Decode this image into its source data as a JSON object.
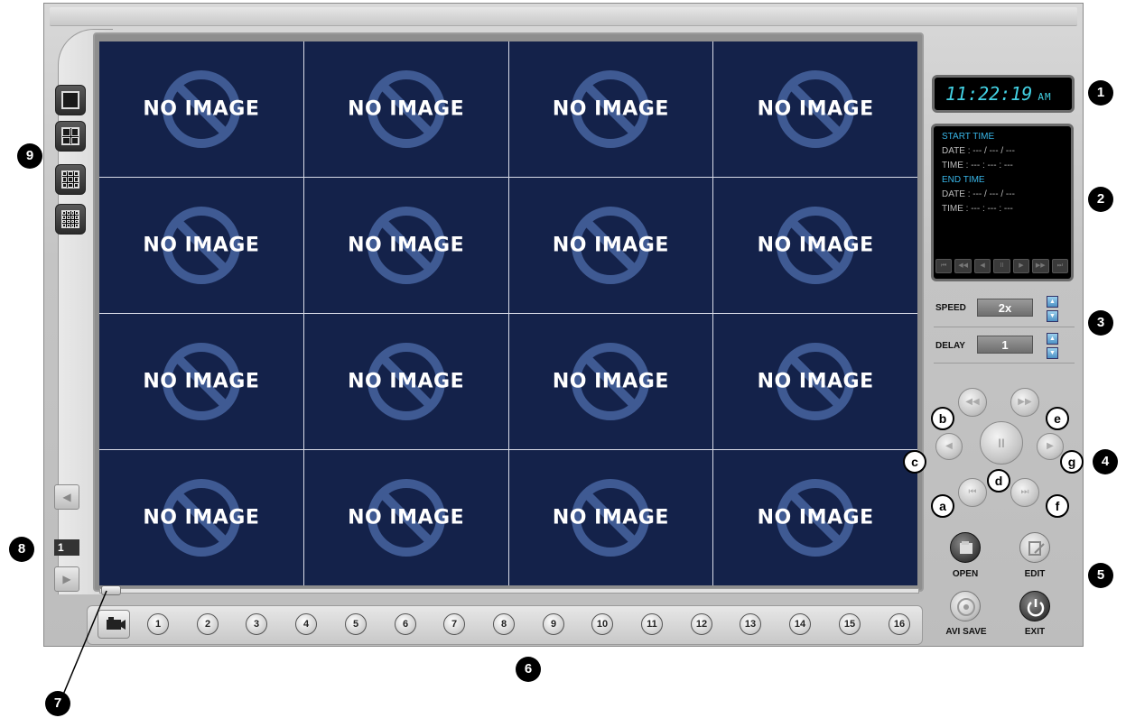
{
  "clock": {
    "time": "11:22:19",
    "ampm": "AM"
  },
  "info": {
    "start_header": "START TIME",
    "start_date": "DATE : --- / --- / ---",
    "start_time": "TIME : --- : --- : ---",
    "end_header": "END TIME",
    "end_date": "DATE : --- / --- / ---",
    "end_time": "TIME : --- : --- : ---"
  },
  "speed": {
    "label": "SPEED",
    "value": "2x"
  },
  "delay": {
    "label": "DELAY",
    "value": "1"
  },
  "grid": {
    "no_image_text": "NO IMAGE",
    "cells": 16,
    "bg_color": "#14224a"
  },
  "page": {
    "number": "1"
  },
  "channels": [
    "1",
    "2",
    "3",
    "4",
    "5",
    "6",
    "7",
    "8",
    "9",
    "10",
    "11",
    "12",
    "13",
    "14",
    "15",
    "16"
  ],
  "buttons": {
    "open": "OPEN",
    "edit": "EDIT",
    "avi_save": "AVI SAVE",
    "exit": "EXIT"
  },
  "callouts": {
    "c1": "1",
    "c2": "2",
    "c3": "3",
    "c4": "4",
    "c5": "5",
    "c6": "6",
    "c7": "7",
    "c8": "8",
    "c9": "9",
    "a": "a",
    "b": "b",
    "c": "c",
    "d": "d",
    "e": "e",
    "f": "f",
    "g": "g"
  },
  "colors": {
    "clock_text": "#43d1e3",
    "info_header": "#38b6e8",
    "accent_blue": "#4d91c4"
  }
}
